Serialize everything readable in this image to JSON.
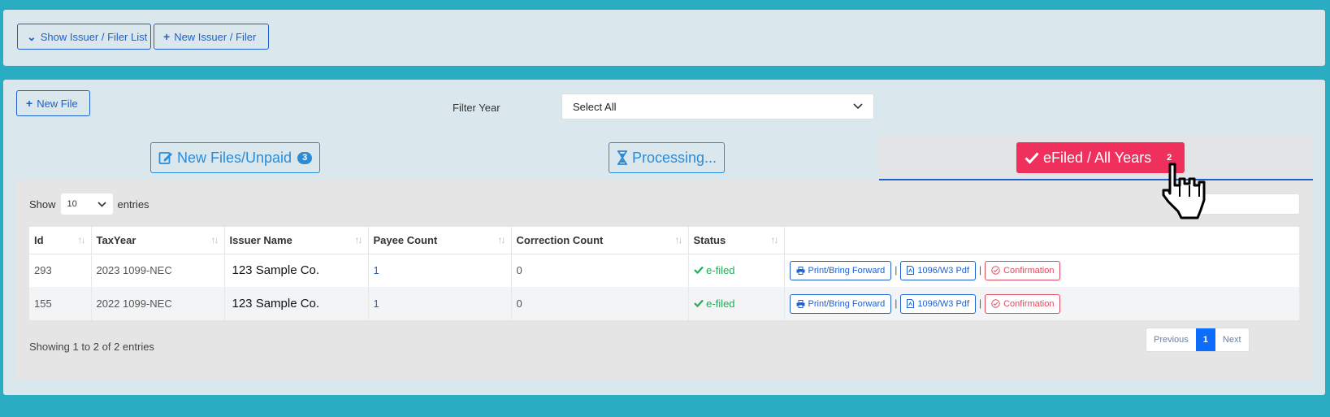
{
  "top_toolbar": {
    "show_list_label": "Show Issuer / Filer List",
    "new_issuer_label": "New Issuer / Filer"
  },
  "main": {
    "new_file_label": "New File",
    "filter_label": "Filter Year",
    "filter_value": "Select All"
  },
  "tabs": [
    {
      "label": "New Files/Unpaid",
      "badge": "3"
    },
    {
      "label": "Processing...",
      "badge": ""
    },
    {
      "label": "eFiled / All Years",
      "badge": "2"
    }
  ],
  "table": {
    "show_label": "Show",
    "entries_label": "entries",
    "page_length": "10",
    "columns": [
      "Id",
      "TaxYear",
      "Issuer Name",
      "Payee Count",
      "Correction Count",
      "Status"
    ],
    "rows": [
      {
        "id": "293",
        "taxyear": "2023 1099-NEC",
        "issuer": "123 Sample Co.",
        "payee": "1",
        "correction": "0",
        "status": "e-filed"
      },
      {
        "id": "155",
        "taxyear": "2022 1099-NEC",
        "issuer": "123 Sample Co.",
        "payee": "1",
        "correction": "0",
        "status": "e-filed"
      }
    ],
    "actions": {
      "print": "Print/Bring Forward",
      "pdf": "1096/W3 Pdf",
      "confirm": "Confirmation",
      "separator": "|"
    },
    "info": "Showing 1 to 2 of 2 entries",
    "pager": {
      "prev": "Previous",
      "current": "1",
      "next": "Next"
    }
  },
  "colors": {
    "accent": "#f0305c",
    "brand_blue": "#1f5fcf",
    "tab_blue": "#2b8bd6",
    "background": "#2aacc2",
    "success": "#1fae55"
  }
}
